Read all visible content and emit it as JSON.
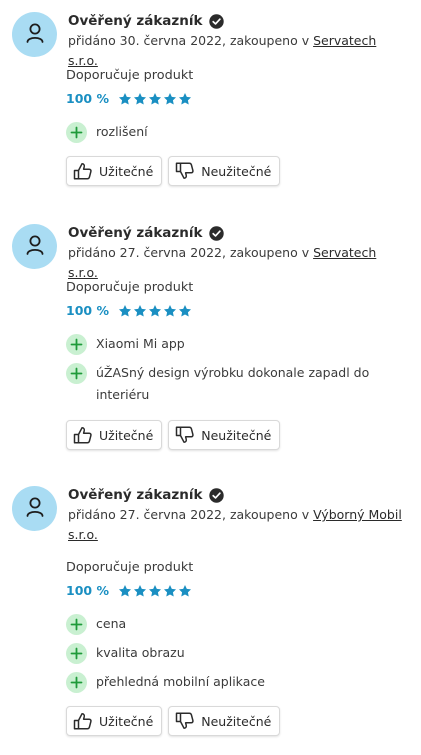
{
  "reviews": [
    {
      "author": "Ověřený zákazník",
      "date_prefix": "přidáno 30. června 2022, zakoupeno v ",
      "shop": "Servatech s.r.o.",
      "recommend_label": "Doporučuje produkt",
      "rating_percent": "100 %",
      "stars": 5,
      "pros": [
        "rozlišení"
      ],
      "helpful_label": "Užitečné",
      "unhelpful_label": "Neužitečné"
    },
    {
      "author": "Ověřený zákazník",
      "date_prefix": "přidáno 27. června 2022, zakoupeno v ",
      "shop": "Servatech s.r.o.",
      "recommend_label": "Doporučuje produkt",
      "rating_percent": "100 %",
      "stars": 5,
      "pros": [
        "Xiaomi Mi app",
        "úŽASný design výrobku dokonale zapadl do interiéru"
      ],
      "helpful_label": "Užitečné",
      "unhelpful_label": "Neužitečné"
    },
    {
      "author": "Ověřený zákazník",
      "date_prefix": "přidáno 27. června 2022, zakoupeno v ",
      "shop": "Výborný Mobil s.r.o.",
      "recommend_label": "Doporučuje produkt",
      "rating_percent": "100 %",
      "stars": 5,
      "pros": [
        "cena",
        "kvalita obrazu",
        "přehledná mobilní aplikace"
      ],
      "helpful_label": "Užitečné",
      "unhelpful_label": "Neužitečné"
    }
  ],
  "icons": {
    "avatar": "user-icon",
    "verified": "check-badge-icon",
    "star": "star-icon",
    "pro": "plus-icon",
    "helpful": "thumbs-up-icon",
    "unhelpful": "thumbs-down-icon"
  },
  "colors": {
    "avatar_bg": "#a9dcf3",
    "rating_blue": "#1a8fc2",
    "pro_bg": "#c9f0d1",
    "pro_plus": "#1f9a3a"
  }
}
